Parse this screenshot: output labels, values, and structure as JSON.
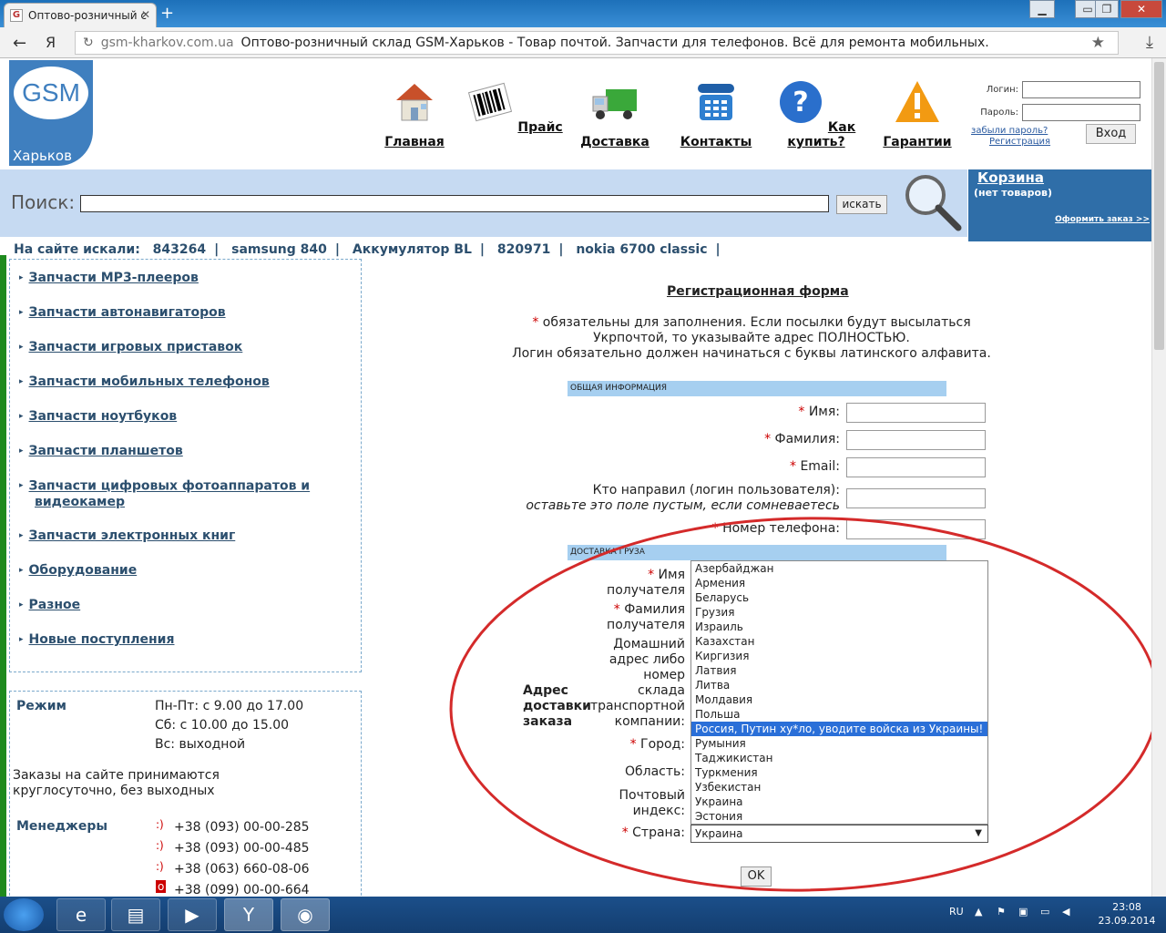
{
  "browser": {
    "tab_title": "Оптово-розничный с",
    "tab_favicon": "G",
    "url_domain": "gsm-kharkov.com.ua",
    "page_title": "Оптово-розничный склад GSM-Харьков - Товар почтой. Запчасти для телефонов. Всё для ремонта мобильных.",
    "yandex_glyph": "Я"
  },
  "logo": {
    "text": "GSM",
    "city": "Харьков"
  },
  "nav": [
    {
      "label": "Главная",
      "icon": "house-icon"
    },
    {
      "label": "Прайс",
      "icon": "barcode-icon"
    },
    {
      "label": "Доставка",
      "icon": "truck-icon"
    },
    {
      "label": "Контакты",
      "icon": "telephone-icon"
    },
    {
      "label": "Как купить?",
      "icon": "question-icon"
    },
    {
      "label": "Гарантии",
      "icon": "warning-icon"
    }
  ],
  "login": {
    "login_label": "Логин:",
    "password_label": "Пароль:",
    "forgot": "забыли пароль?",
    "register": "Регистрация",
    "submit": "Вход"
  },
  "search": {
    "label": "Поиск:",
    "button": "искать"
  },
  "cart": {
    "title": "Корзина",
    "status": "(нет товаров)",
    "checkout": "Оформить заказ >>"
  },
  "searched": {
    "label": "На сайте искали:",
    "items": [
      "843264",
      "samsung 840",
      "Аккумулятор BL",
      "820971",
      "nokia 6700 classic"
    ]
  },
  "categories": [
    "Запчасти MP3-плееров",
    "Запчасти автонавигаторов",
    "Запчасти игровых приставок",
    "Запчасти мобильных телефонов",
    "Запчасти ноутбуков",
    "Запчасти планшетов",
    "Запчасти цифровых фотоаппаратов и",
    "видеокамер",
    "Запчасти электронных книг",
    "Оборудование",
    "Разное",
    "Новые поступления"
  ],
  "schedule": {
    "label": "Режим",
    "lines": [
      "Пн-Пт: с 9.00 до 17.00",
      "Сб: с 10.00 до 15.00",
      "Вс: выходной"
    ],
    "note1": "Заказы на сайте принимаются",
    "note2": "круглосуточно, без выходных",
    "managers_label": "Менеджеры",
    "phones": [
      "+38 (093) 00-00-285",
      "+38 (093) 00-00-485",
      "+38 (063) 660-08-06",
      "+38 (099) 00-00-664"
    ]
  },
  "form": {
    "title": "Регистрационная форма",
    "note_star": "*",
    "note1": " обязательны для заполнения. Если посылки будут высылаться",
    "note2": "Укрпочтой, то указывайте адрес ПОЛНОСТЬЮ.",
    "note3": "Логин обязательно должен начинаться с буквы латинского алфавита.",
    "section1": "ОБЩАЯ ИНФОРМАЦИЯ",
    "name": "Имя:",
    "surname": "Фамилия:",
    "email": "Email:",
    "referrer1": "Кто направил (логин пользователя):",
    "referrer2": "оставьте это поле пустым, если сомневаетесь",
    "phone": "Номер телефона:",
    "section2": "ДОСТАВКА ГРУЗА",
    "addr_label1": "Адрес",
    "addr_label2": "доставки",
    "addr_label3": "заказа",
    "recipient_name1": "Имя",
    "recipient_name2": "получателя",
    "recipient_surname1": "Фамилия",
    "recipient_surname2": "получателя",
    "home1": "Домашний",
    "home2": "адрес либо",
    "home3": "номер",
    "home4": "склада",
    "home5": "транспортной",
    "home6": "компании:",
    "city": "Город:",
    "region": "Область:",
    "postal1": "Почтовый",
    "postal2": "индекс:",
    "country": "Страна:",
    "country_value": "Украина",
    "ok": "OK"
  },
  "countries": [
    "Азербайджан",
    "Армения",
    "Беларусь",
    "Грузия",
    "Израиль",
    "Казахстан",
    "Киргизия",
    "Латвия",
    "Литва",
    "Молдавия",
    "Польша",
    "Россия, Путин ху*ло, уводите войска из Украины!",
    "Румыния",
    "Таджикистан",
    "Туркмения",
    "Узбекистан",
    "Украина",
    "Эстония"
  ],
  "selected_country_index": 11,
  "taskbar": {
    "lang": "RU",
    "time": "23:08",
    "date": "23.09.2014"
  },
  "colors": {
    "accent": "#2f6ea8",
    "search_bg": "#c6daf2",
    "section_bg": "#a6cff0",
    "annotation": "#d42a2a"
  }
}
